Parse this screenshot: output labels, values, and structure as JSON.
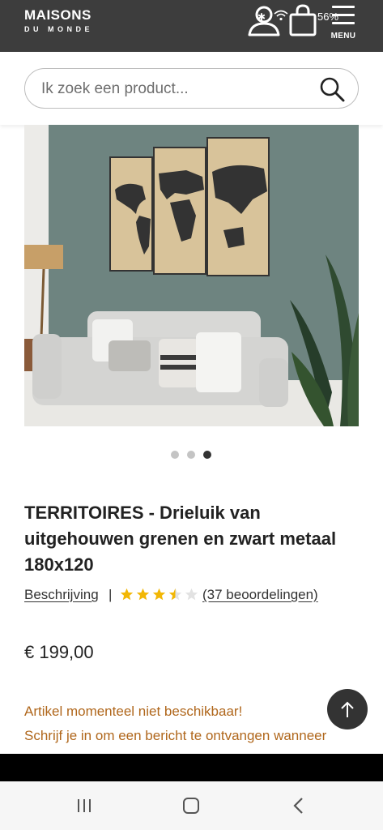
{
  "header": {
    "logo_line1": "MAISONS",
    "logo_line2": "DU MONDE",
    "menu_label": "MENU",
    "status_battery": "56%",
    "icons": [
      "user-icon",
      "shopping-bag-icon",
      "menu-icon",
      "bluetooth-icon",
      "wifi-icon"
    ]
  },
  "search": {
    "placeholder": "Ik zoek een product...",
    "icon": "search-icon"
  },
  "gallery": {
    "image": "product-image-world-map-triptych",
    "dot_count": 3,
    "active_dot": 3
  },
  "product": {
    "title": "TERRITOIRES - Drieluik van uitgehouwen grenen en zwart metaal 180x120",
    "description_link": "Beschrijving",
    "separator": "|",
    "rating": 3.5,
    "rating_max": 5,
    "reviews_link": "(37 beoordelingen)",
    "price": "€ 199,00",
    "availability": "Artikel momenteel niet beschikbaar!",
    "notify_text": "Schrijf je in om een bericht te ontvangen wanneer"
  },
  "colors": {
    "header_bg": "#3d3d3d",
    "availability_text": "#b0671c",
    "star_filled": "#f2b705",
    "star_empty": "#e2e2e2"
  },
  "navigation": {
    "buttons": [
      "recent-apps-icon",
      "home-icon",
      "back-icon"
    ]
  }
}
